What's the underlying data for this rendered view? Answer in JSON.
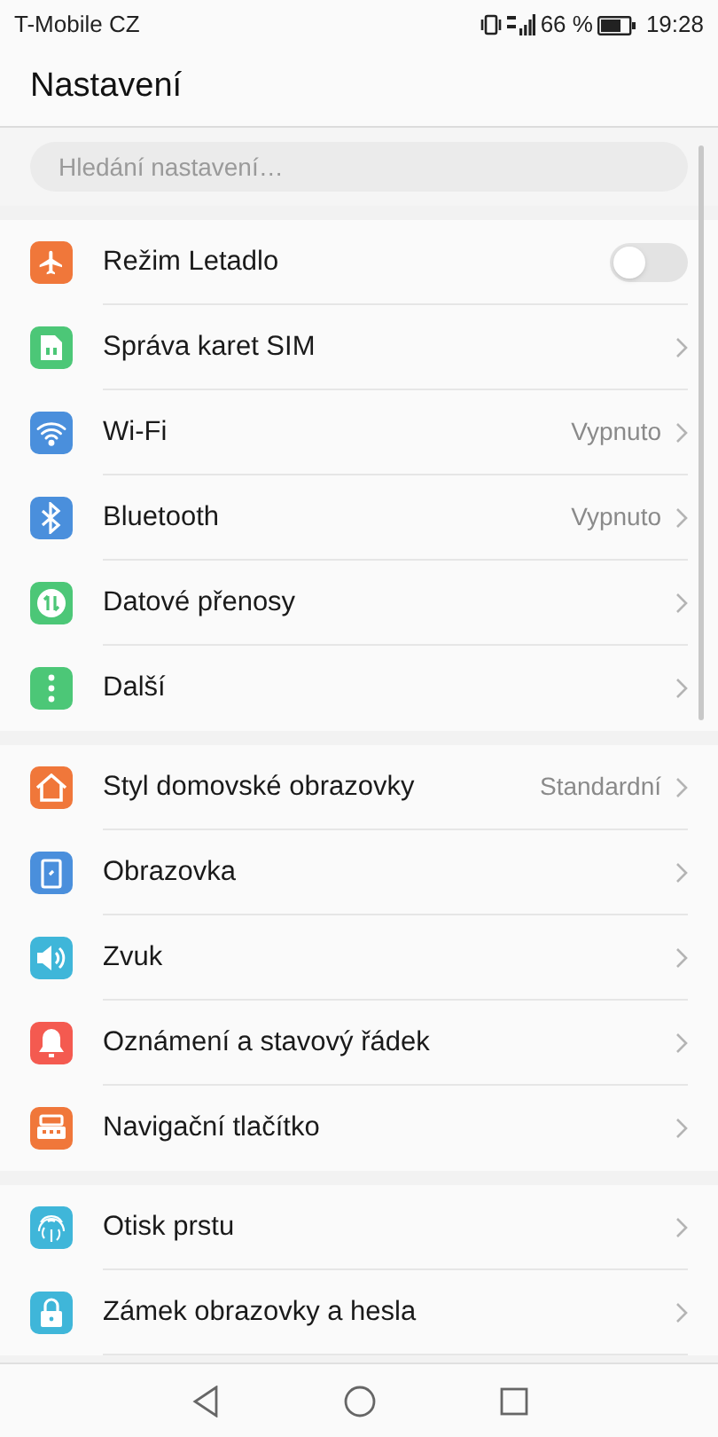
{
  "status_bar": {
    "carrier": "T-Mobile CZ",
    "battery_text": "66 %",
    "time": "19:28"
  },
  "header": {
    "title": "Nastavení"
  },
  "search": {
    "placeholder": "Hledání nastavení…"
  },
  "sections": [
    {
      "items": [
        {
          "kind": "toggle",
          "label": "Režim Letadlo",
          "on": false,
          "color": "#f0773a"
        },
        {
          "kind": "link",
          "label": "Správa karet SIM",
          "color": "#4cc777"
        },
        {
          "kind": "link",
          "label": "Wi-Fi",
          "value": "Vypnuto",
          "color": "#4a8fdc"
        },
        {
          "kind": "link",
          "label": "Bluetooth",
          "value": "Vypnuto",
          "color": "#4a8fdc"
        },
        {
          "kind": "link",
          "label": "Datové přenosy",
          "color": "#4cc777"
        },
        {
          "kind": "link",
          "label": "Další",
          "color": "#4cc777"
        }
      ]
    },
    {
      "items": [
        {
          "kind": "link",
          "label": "Styl domovské obrazovky",
          "value": "Standardní",
          "color": "#f0773a"
        },
        {
          "kind": "link",
          "label": "Obrazovka",
          "color": "#4a8fdc"
        },
        {
          "kind": "link",
          "label": "Zvuk",
          "color": "#3fb6d9"
        },
        {
          "kind": "link",
          "label": "Oznámení a stavový řádek",
          "color": "#f45a50"
        },
        {
          "kind": "link",
          "label": "Navigační tlačítko",
          "color": "#f0773a"
        }
      ]
    },
    {
      "items": [
        {
          "kind": "link",
          "label": "Otisk prstu",
          "color": "#3fb6d9"
        },
        {
          "kind": "link",
          "label": "Zámek obrazovky a hesla",
          "color": "#3fb6d9"
        }
      ]
    }
  ]
}
